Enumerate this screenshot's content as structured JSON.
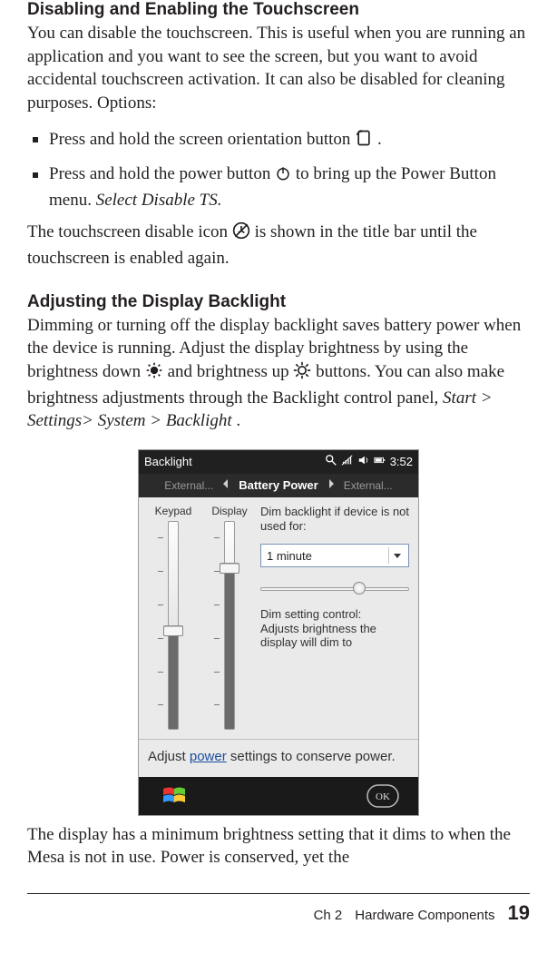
{
  "section1": {
    "title": "Disabling and Enabling the Touchscreen",
    "p1": "You can disable the touchscreen. This is useful when you are running an application and you want to see the screen, but you want to avoid accidental touchscreen activation. It can also be disabled for cleaning purposes. Options:",
    "li1": "Press and hold the screen orientation button ",
    "li1_end": ".",
    "li2a": "Press and hold the power button ",
    "li2b": " to bring up the Power Button menu. ",
    "li2c": "Select Disable TS.",
    "after_a": "The touchscreen disable icon ",
    "after_b": " is shown in the title bar until the touchscreen is enabled again."
  },
  "section2": {
    "title": "Adjusting the Display Backlight",
    "p1a": "Dimming or turning off the display backlight saves battery power when the device is running. Adjust the display brightness by using the brightness down ",
    "p1b": " and brightness up ",
    "p1c": " buttons. You can also make brightness adjustments through the Backlight control panel, ",
    "p1_path": "Start > Settings> System > Backlight",
    "p1d": "."
  },
  "figure": {
    "titlebar": {
      "title": "Backlight",
      "clock": "3:52"
    },
    "tabs": {
      "left": "External...",
      "active": "Battery Power",
      "right": "External..."
    },
    "sliders": {
      "keypad": "Keypad",
      "display": "Display",
      "keypad_pos": 0.48,
      "display_pos": 0.78
    },
    "right": {
      "dim_label": "Dim backlight if device is not used for:",
      "select_value": "1 minute",
      "dim_setting_title": "Dim setting control:",
      "dim_setting_desc": "Adjusts brightness the display will dim to",
      "mini_pos": 0.62
    },
    "bottom": {
      "pre": "Adjust ",
      "link": "power",
      "post": " settings to conserve power."
    },
    "softbar": {
      "left": "windows-flag",
      "right": "OK"
    }
  },
  "after_figure": "The display has a minimum brightness setting that it dims to when the Mesa is not in use. Power is conserved, yet the",
  "footer": {
    "chapter": "Ch 2",
    "label": "Hardware Components",
    "page": "19"
  }
}
